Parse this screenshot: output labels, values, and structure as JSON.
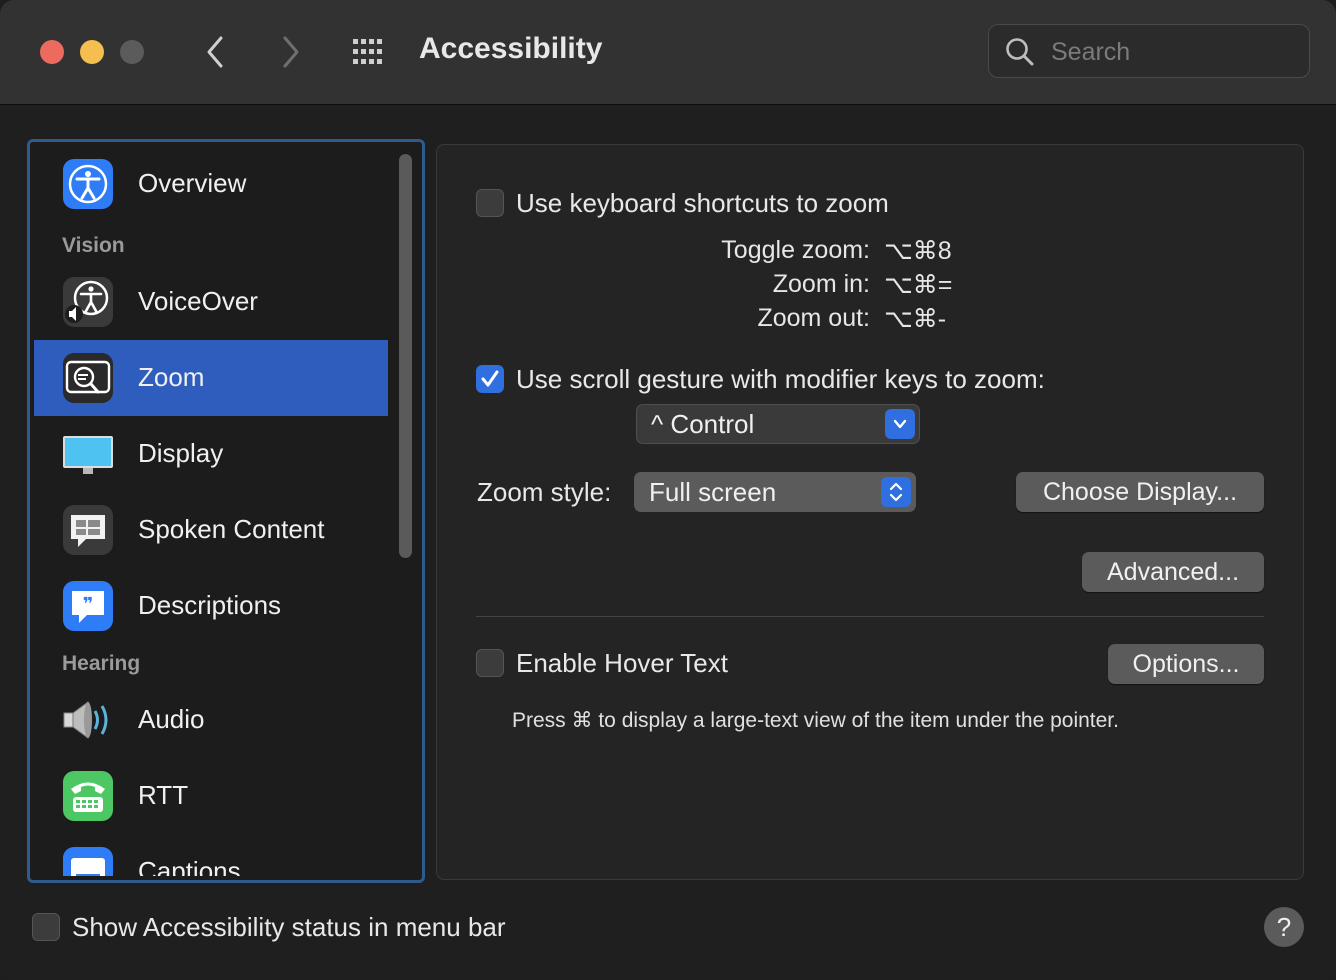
{
  "window": {
    "title": "Accessibility",
    "search": {
      "placeholder": "Search",
      "value": ""
    }
  },
  "sidebar": {
    "sections": [
      "Vision",
      "Hearing"
    ],
    "items": [
      {
        "label": "Overview",
        "icon": "accessibility-icon"
      },
      {
        "label": "VoiceOver",
        "icon": "voiceover-icon"
      },
      {
        "label": "Zoom",
        "icon": "zoom-icon",
        "selected": true
      },
      {
        "label": "Display",
        "icon": "display-icon"
      },
      {
        "label": "Spoken Content",
        "icon": "spoken-content-icon"
      },
      {
        "label": "Descriptions",
        "icon": "descriptions-icon"
      },
      {
        "label": "Audio",
        "icon": "speaker-icon"
      },
      {
        "label": "RTT",
        "icon": "telephone-icon"
      },
      {
        "label": "Captions",
        "icon": "captions-icon"
      }
    ]
  },
  "zoom": {
    "keyboard_shortcuts": {
      "label": "Use keyboard shortcuts to zoom",
      "checked": false
    },
    "shortcuts": [
      {
        "name": "Toggle zoom:",
        "keys": "⌥⌘8"
      },
      {
        "name": "Zoom in:",
        "keys": "⌥⌘="
      },
      {
        "name": "Zoom out:",
        "keys": "⌥⌘-"
      }
    ],
    "scroll_gesture": {
      "label": "Use scroll gesture with modifier keys to zoom:",
      "checked": true
    },
    "modifier_key": "^ Control",
    "zoom_style_label": "Zoom style:",
    "zoom_style_value": "Full screen",
    "choose_display_label": "Choose Display...",
    "advanced_label": "Advanced...",
    "hover_text": {
      "label": "Enable Hover Text",
      "checked": false
    },
    "options_label": "Options...",
    "hover_hint": "Press ⌘ to display a large-text view of the item under the pointer."
  },
  "footer": {
    "status_menu": {
      "label": "Show Accessibility status in menu bar",
      "checked": false
    },
    "help_label": "?"
  },
  "colors": {
    "accent": "#2f6fe0",
    "selection": "#2f5dbe",
    "focus_ring": "#2e5a8c"
  }
}
